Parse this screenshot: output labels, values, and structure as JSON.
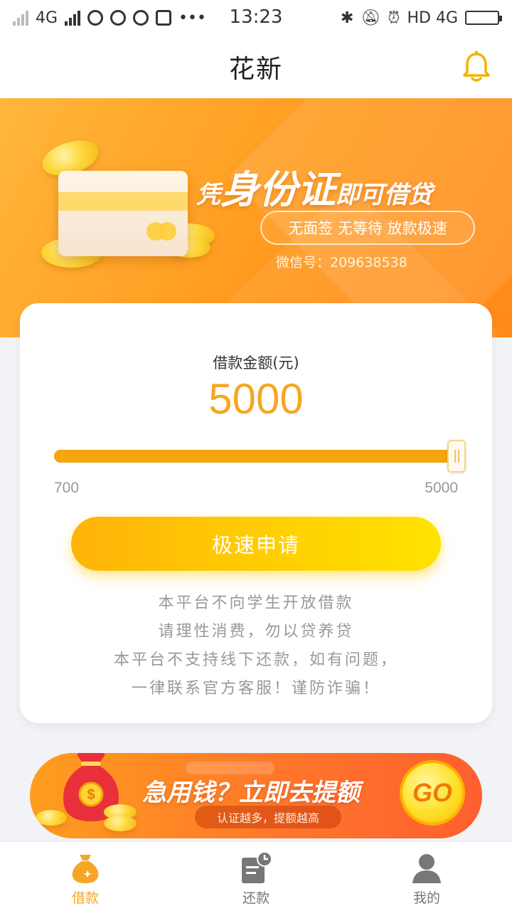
{
  "status_bar": {
    "network": "4G",
    "time": "13:23",
    "right_text": "HD 4G"
  },
  "header": {
    "title": "花新"
  },
  "banner": {
    "headline_small_1": "凭",
    "headline_big": "身份证",
    "headline_small_2": "即可借贷",
    "pill_text": "无面签  无等待  放款极速",
    "wechat": "微信号：209638538"
  },
  "loan": {
    "amount_label": "借款金额(元)",
    "amount_value": "5000",
    "range_min": "700",
    "range_max": "5000",
    "slider_fraction": 1.0,
    "apply_label": "极速申请",
    "notice_lines": [
      "本平台不向学生开放借款",
      "请理性消费，勿以贷养贷",
      "本平台不支持线下还款，如有问题，",
      "一律联系官方客服！谨防诈骗！"
    ]
  },
  "promo": {
    "title": "急用钱？立即去提额",
    "subtitle": "认证越多，提额越高",
    "go_label": "GO"
  },
  "nav": {
    "items": [
      {
        "label": "借款",
        "icon": "moneybag-icon",
        "active": true
      },
      {
        "label": "还款",
        "icon": "bill-clock-icon",
        "active": false
      },
      {
        "label": "我的",
        "icon": "user-icon",
        "active": false
      }
    ]
  },
  "colors": {
    "accent": "#f5a623",
    "button_start": "#ffb30a",
    "button_end": "#ffe200",
    "banner": "#ff9a1f"
  }
}
